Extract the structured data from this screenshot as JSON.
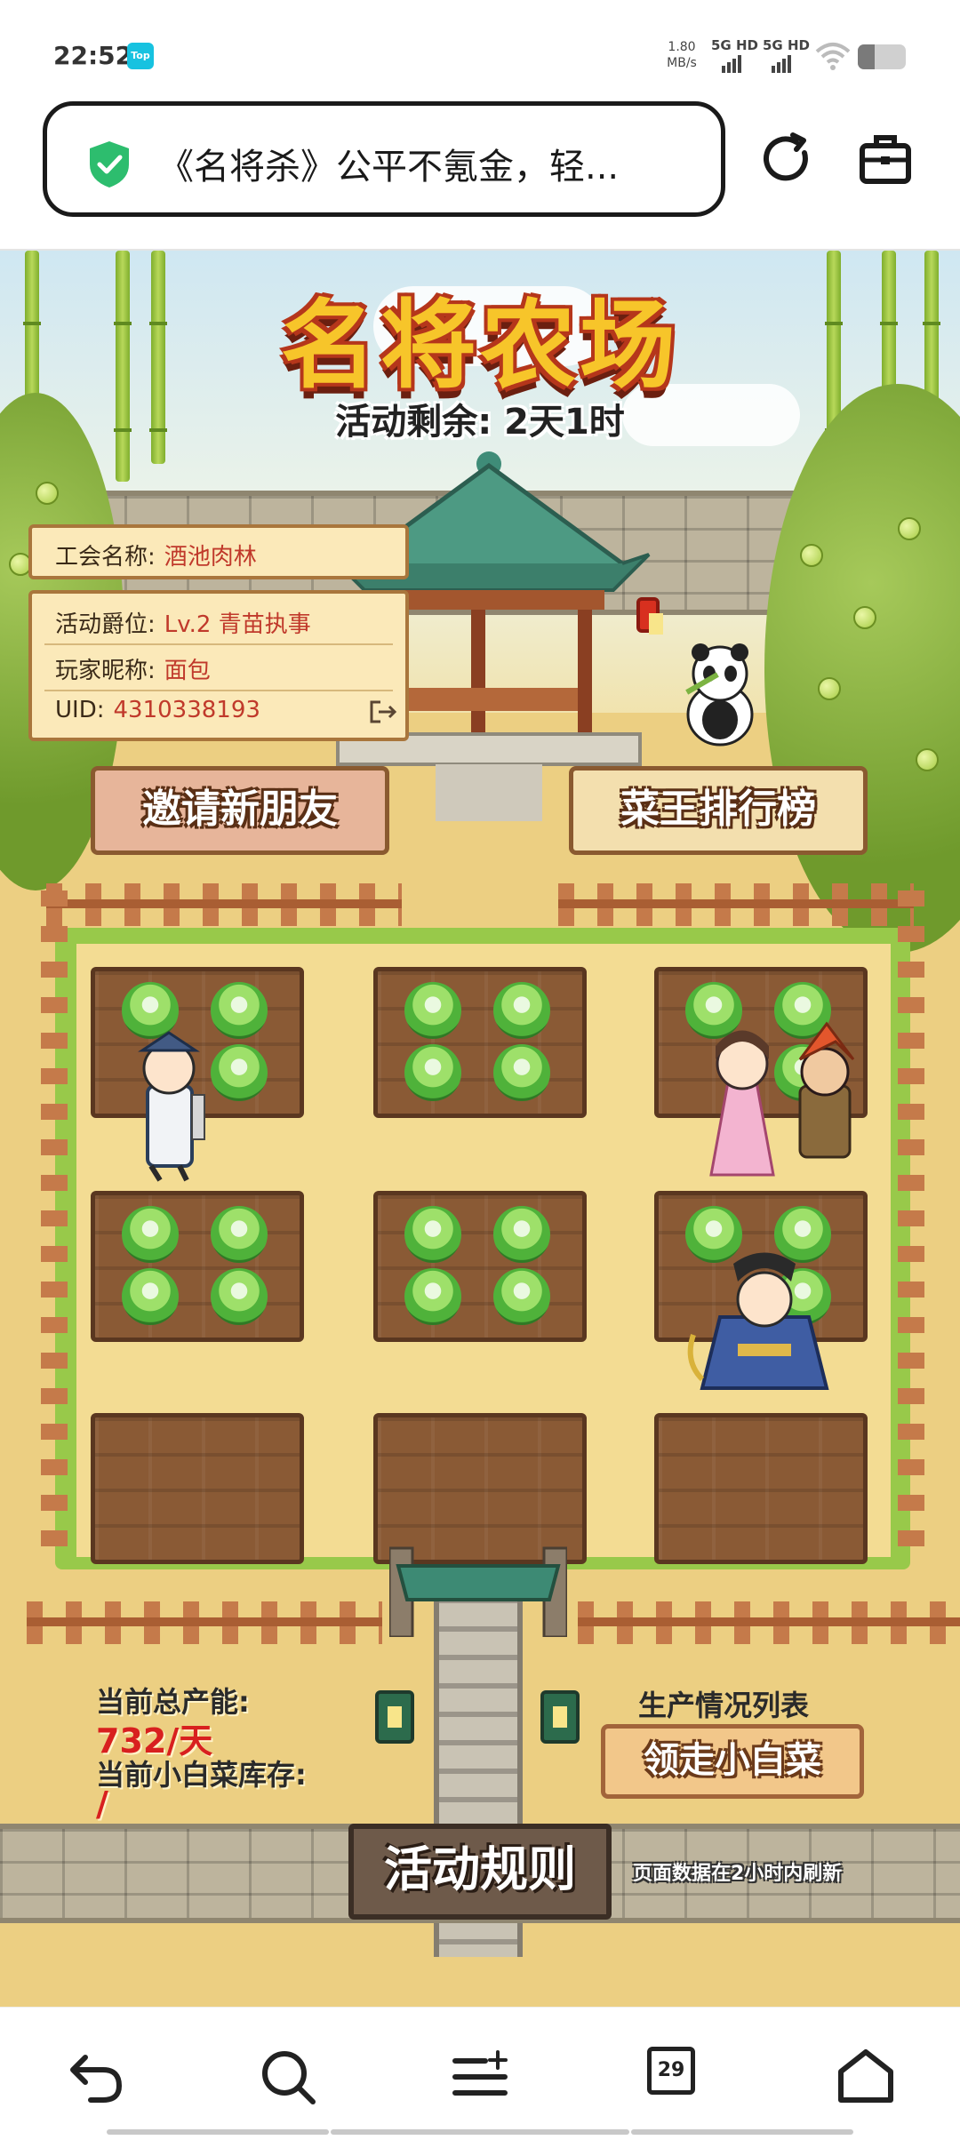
{
  "status_bar": {
    "time": "22:52",
    "app_badge": "Top",
    "net_speed_value": "1.80",
    "net_speed_unit": "MB/s",
    "sim1": "5G HD",
    "sim2": "5G HD",
    "battery_level": 0.35
  },
  "browser": {
    "page_title": "《名将杀》公平不氪金，轻...",
    "shield_color": "#2dbd6e"
  },
  "game": {
    "title": "名将农场",
    "remaining": "活动剩余: 2天1时",
    "guild_label": "工会名称:",
    "guild_value": "酒池肉林",
    "rank_label": "活动爵位:",
    "rank_value": "Lv.2 青苗执事",
    "nick_label": "玩家昵称:",
    "nick_value": "面包",
    "uid_label": "UID:",
    "uid_value": "4310338193",
    "invite_button": "邀请新朋友",
    "leaderboard_button": "菜王排行榜",
    "capacity_label": "当前总产能:",
    "capacity_value": "732/天",
    "stock_label": "当前小白菜库存:",
    "stock_value": "/",
    "production_list": "生产情况列表",
    "claim_button": "领走小白菜",
    "rules_button": "活动规则",
    "refresh_note": "页面数据在2小时内刷新",
    "plots": [
      {
        "cabbages": 3
      },
      {
        "cabbages": 4
      },
      {
        "cabbages": 3
      },
      {
        "cabbages": 4
      },
      {
        "cabbages": 4
      },
      {
        "cabbages": 3
      },
      {
        "cabbages": 0
      },
      {
        "cabbages": 0
      },
      {
        "cabbages": 0
      }
    ]
  },
  "nav": {
    "tabs_count": "29",
    "icons": [
      "back-icon",
      "search-icon",
      "menu-icon",
      "tabs-icon",
      "home-icon"
    ]
  }
}
